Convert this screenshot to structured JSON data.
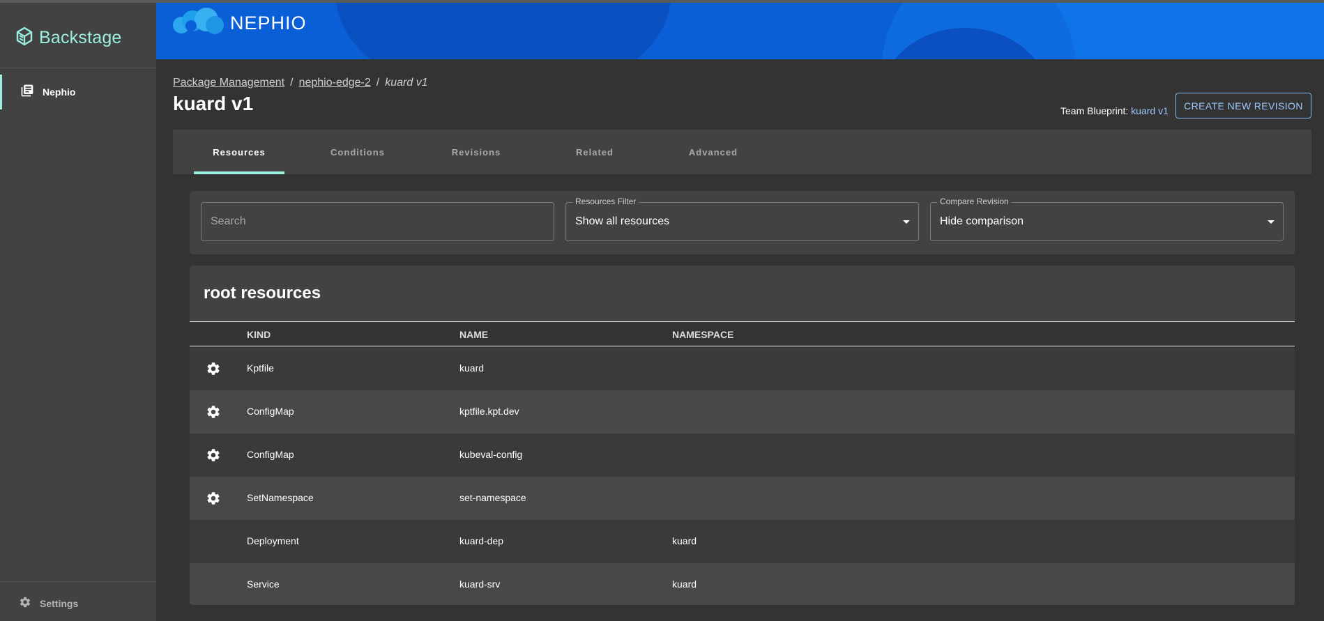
{
  "sidebar": {
    "brand": "Backstage",
    "items": [
      {
        "label": "Nephio",
        "icon": "library-books-icon"
      }
    ],
    "settings_label": "Settings"
  },
  "header": {
    "logo_text": "NEPHIO"
  },
  "breadcrumb": {
    "items": [
      "Package Management",
      "nephio-edge-2"
    ],
    "current": "kuard v1",
    "separator": "/"
  },
  "page": {
    "title": "kuard v1",
    "blueprint_label": "Team Blueprint:",
    "blueprint_link": "kuard v1",
    "create_button": "CREATE NEW REVISION"
  },
  "tabs": [
    {
      "label": "Resources",
      "active": true
    },
    {
      "label": "Conditions",
      "active": false
    },
    {
      "label": "Revisions",
      "active": false
    },
    {
      "label": "Related",
      "active": false
    },
    {
      "label": "Advanced",
      "active": false
    }
  ],
  "filters": {
    "search_placeholder": "Search",
    "resources_filter": {
      "label": "Resources Filter",
      "value": "Show all resources"
    },
    "compare_revision": {
      "label": "Compare Revision",
      "value": "Hide comparison"
    }
  },
  "table": {
    "title": "root resources",
    "columns": [
      "KIND",
      "NAME",
      "NAMESPACE"
    ],
    "rows": [
      {
        "kind": "Kptfile",
        "name": "kuard",
        "namespace": "",
        "icon": "gear-icon"
      },
      {
        "kind": "ConfigMap",
        "name": "kptfile.kpt.dev",
        "namespace": "",
        "icon": "gear-icon"
      },
      {
        "kind": "ConfigMap",
        "name": "kubeval-config",
        "namespace": "",
        "icon": "gear-icon"
      },
      {
        "kind": "SetNamespace",
        "name": "set-namespace",
        "namespace": "",
        "icon": "gear-icon"
      },
      {
        "kind": "Deployment",
        "name": "kuard-dep",
        "namespace": "kuard",
        "icon": ""
      },
      {
        "kind": "Service",
        "name": "kuard-srv",
        "namespace": "kuard",
        "icon": ""
      }
    ]
  },
  "colors": {
    "accent": "#9BF0E1",
    "banner": "#0A5FD6",
    "link": "#9CC9FF"
  }
}
